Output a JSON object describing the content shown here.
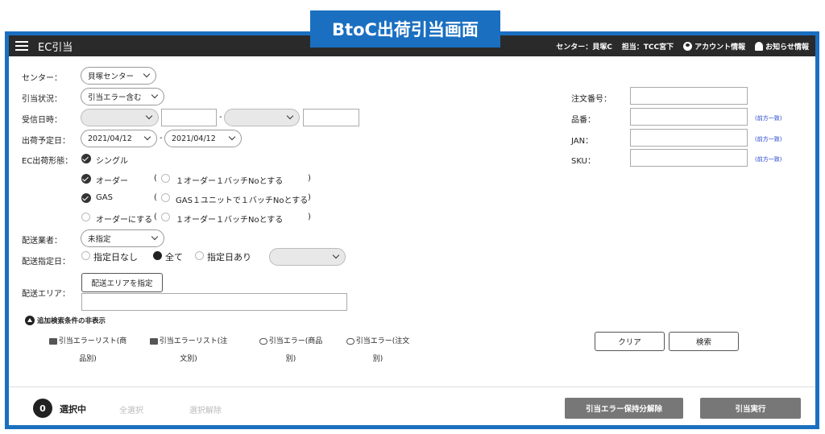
{
  "banner": "BtoC出荷引当画面",
  "app": {
    "title": "EC引当",
    "center_info": "センター：貝塚C",
    "staff_info": "担当：TCC宮下",
    "account_label": "アカウント情報",
    "notice_label": "お知らせ情報"
  },
  "form": {
    "center_label": "センター：",
    "center_value": "貝塚センター",
    "status_label": "引当状況：",
    "status_value": "引当エラー含む",
    "received_label": "受信日時：",
    "date_sep": "-",
    "ship_label": "出荷予定日：",
    "ship_from": "2021/04/12",
    "ship_to": "2021/04/12",
    "shape_label": "EC出荷形態：",
    "single_label": "シングル",
    "order_label": "オーダー",
    "order_paren_open": "(",
    "order_option": "１オーダー１バッチNoとする",
    "paren_close": ")",
    "gas_label": "GAS",
    "gas_option": "GAS１ユニットで１バッチNoとする",
    "order_convert_label": "オーダーにする",
    "order_convert_paren": "(",
    "order_convert_option": "１オーダー１バッチNoとする",
    "carrier_label": "配送業者：",
    "carrier_value": "未指定",
    "delivery_date_label": "配送指定日：",
    "no_date_label": "指定日なし",
    "all_label": "全て",
    "with_date_label": "指定日あり",
    "area_label": "配送エリア：",
    "area_button": "配送エリアを指定",
    "toggle_label": "追加検索条件の非表示",
    "order_no_label": "注文番号：",
    "item_no_label": "品番：",
    "jan_label": "JAN：",
    "sku_label": "SKU：",
    "prefix_note": "(前方一致)"
  },
  "downloads": [
    {
      "line1": "引当エラーリスト(商",
      "line2": "品別)"
    },
    {
      "line1": "引当エラーリスト(注",
      "line2": "文別)"
    },
    {
      "line1": "引当エラー(商品",
      "line2": "別)"
    },
    {
      "line1": "引当エラー(注文",
      "line2": "別)"
    }
  ],
  "actions": {
    "clear": "クリア",
    "search": "検索"
  },
  "footer": {
    "count": "0",
    "selected_label": "選択中",
    "select_all": "全選択",
    "deselect": "選択解除",
    "release_button": "引当エラー保持分解除",
    "execute_button": "引当実行"
  }
}
